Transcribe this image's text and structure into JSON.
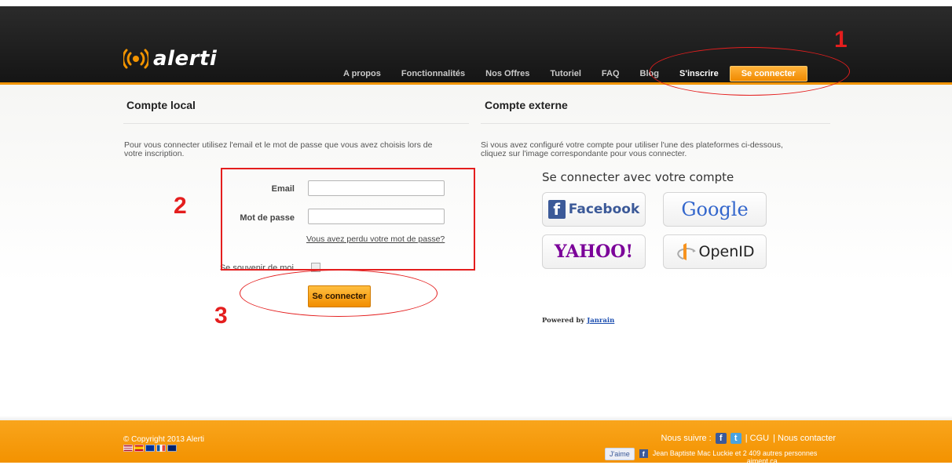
{
  "colors": {
    "accent": "#f29400",
    "annotation": "#e41e1e",
    "header": "#1c1c1c"
  },
  "header": {
    "logo_text": "alerti",
    "nav": [
      "A propos",
      "Fonctionnalités",
      "Nos Offres",
      "Tutoriel",
      "FAQ",
      "Blog"
    ],
    "signup": "S'inscrire",
    "connect": "Se connecter"
  },
  "local": {
    "title": "Compte local",
    "description_line1": "Pour vous connecter utilisez l'email et le mot de passe que vous avez choisis lors de",
    "description_line2": "votre inscription.",
    "email_label": "Email",
    "email_value": "",
    "password_label": "Mot de passe",
    "password_value": "",
    "forgot": "Vous avez perdu votre mot de passe?",
    "remember": "Se souvenir de moi",
    "submit": "Se connecter"
  },
  "external": {
    "title": "Compte externe",
    "description_line1": "Si vous avez configuré votre compte pour utiliser l'une des plateformes ci-dessous,",
    "description_line2": "cliquez sur l'image correspondante pour vous connecter.",
    "providers_title": "Se connecter avec votre compte",
    "providers": [
      "Facebook",
      "Google",
      "YAHOO!",
      "OpenID"
    ],
    "powered_by": "Powered by",
    "powered_link": "Janrain"
  },
  "annotations": [
    "1",
    "2",
    "3"
  ],
  "footer": {
    "copyright": "© Copyright 2013 Alerti",
    "follow": "Nous suivre :",
    "cgu": "| CGU",
    "contact": "| Nous contacter",
    "like": "J'aime",
    "like_line1": "Jean Baptiste Mac Luckie et 2 409 autres personnes",
    "like_line2": "aiment ça."
  }
}
